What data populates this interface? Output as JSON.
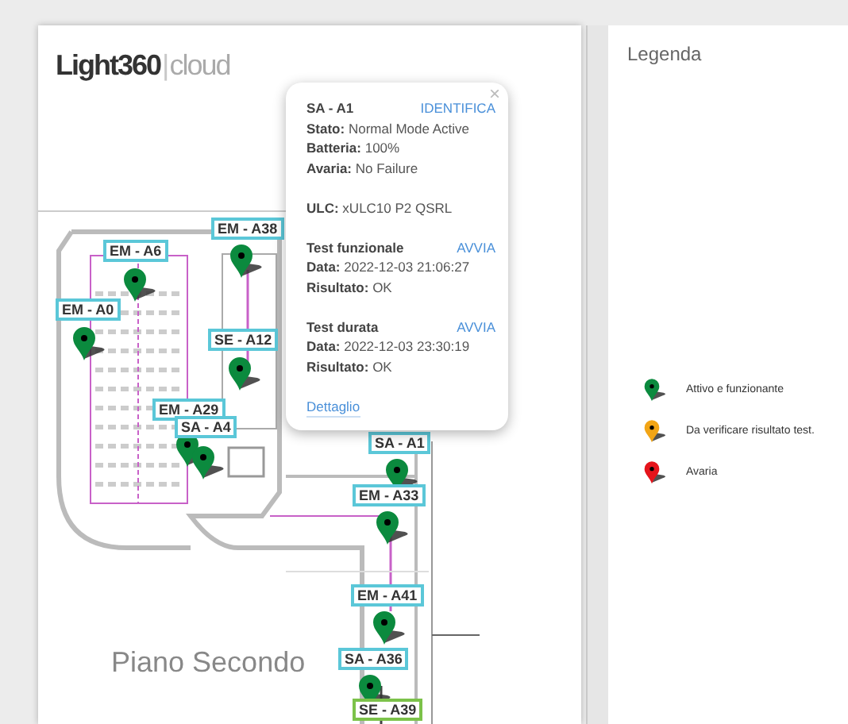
{
  "logo": {
    "brand": "Light360",
    "separator": "|",
    "suffix": "cloud"
  },
  "floor_name": "Piano Secondo",
  "markers": [
    {
      "label": "EM - A38",
      "kind": "normal",
      "color": "#0b8a3e"
    },
    {
      "label": "EM - A6",
      "kind": "normal",
      "color": "#0b8a3e"
    },
    {
      "label": "EM - A0",
      "kind": "normal",
      "color": "#0b8a3e"
    },
    {
      "label": "SE - A12",
      "kind": "normal",
      "color": "#0b8a3e"
    },
    {
      "label": "EM - A29",
      "kind": "normal",
      "color": "#0b8a3e"
    },
    {
      "label": "SA - A4",
      "kind": "normal",
      "color": "#0b8a3e"
    },
    {
      "label": "SA - A1",
      "kind": "normal",
      "color": "#0b8a3e"
    },
    {
      "label": "EM - A33",
      "kind": "normal",
      "color": "#0b8a3e"
    },
    {
      "label": "EM - A41",
      "kind": "normal",
      "color": "#0b8a3e"
    },
    {
      "label": "SA - A36",
      "kind": "normal",
      "color": "#0b8a3e"
    },
    {
      "label": "SE - A39",
      "kind": "highlighted"
    }
  ],
  "popup": {
    "close": "×",
    "title": "SA - A1",
    "action": "IDENTIFICA",
    "fields": [
      "**Stato:** Normal Mode Active",
      "**Batteria:** 100%",
      "**Avaria:** No Failure"
    ],
    "ulc": "**ULC:** xULC10 P2 QSRL",
    "tests": [
      {
        "name": "Test funzionale",
        "action": "AVVIA",
        "date": "**Data:** 2022-12-03 21:06:27",
        "result": "**Risultato:** OK"
      },
      {
        "name": "Test durata",
        "action": "AVVIA",
        "date": "**Data:** 2022-12-03 23:30:19",
        "result": "**Risultato:** OK"
      }
    ],
    "link": "Dettaglio"
  },
  "legend": {
    "title": "Legenda",
    "items": [
      {
        "label": "Attivo e funzionante",
        "color": "#0b8a3e"
      },
      {
        "label": "Da verificare risultato test.",
        "color": "#f2a516"
      },
      {
        "label": "Avaria",
        "color": "#e5141b"
      }
    ]
  }
}
